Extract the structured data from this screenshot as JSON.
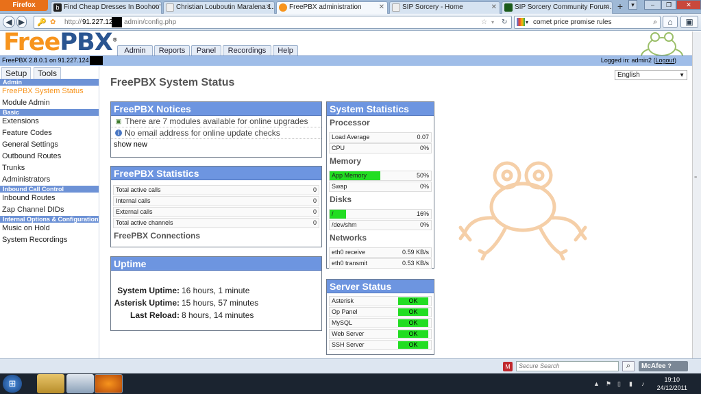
{
  "browser": {
    "menu_button": "Firefox",
    "tabs": [
      {
        "label": "Find Cheap Dresses In Boohoo'...",
        "icon": "b",
        "icon_color": "#222222"
      },
      {
        "label": "Christian Louboutin Maralena 1...",
        "icon": "",
        "icon_color": "#ffffff"
      },
      {
        "label": "FreePBX administration",
        "icon": "",
        "icon_color": "#f7941d"
      },
      {
        "label": "SIP Sorcery - Home",
        "icon": "",
        "icon_color": "#ffffff"
      },
      {
        "label": "SIP Sorcery Community Forum...",
        "icon": "",
        "icon_color": "#1a5a1a"
      }
    ],
    "new_tab": "+",
    "url_scheme": "http://",
    "url_host": "91.227.124",
    "url_path": "admin/config.php",
    "search_text": "comet price promise rules",
    "status_search_placeholder": "Secure Search",
    "mcafee": "McAfee"
  },
  "header": {
    "logo_free": "Free",
    "logo_pbx": "PBX",
    "logo_reg": "®",
    "version": "FreePBX 2.8.0.1 on 91.227.124",
    "logged_in_prefix": "Logged in: admin2 (",
    "logout": "Logout",
    "logged_in_suffix": ")",
    "menu": [
      "Admin",
      "Reports",
      "Panel",
      "Recordings",
      "Help"
    ]
  },
  "sidebar": {
    "tabs": [
      "Setup",
      "Tools"
    ],
    "sections": {
      "admin": "Admin",
      "basic": "Basic",
      "inbound": "Inbound Call Control",
      "internal": "Internal Options & Configuration"
    },
    "admin_items": [
      "FreePBX System Status",
      "Module Admin"
    ],
    "basic_items": [
      "Extensions",
      "Feature Codes",
      "General Settings",
      "Outbound Routes",
      "Trunks",
      "Administrators"
    ],
    "inbound_items": [
      "Inbound Routes",
      "Zap Channel DIDs"
    ],
    "internal_items": [
      "Music on Hold",
      "System Recordings"
    ]
  },
  "main": {
    "title": "FreePBX System Status",
    "language": "English",
    "notices": {
      "title": "FreePBX Notices",
      "items": [
        "There are 7 modules available for online upgrades",
        "No email address for online update checks"
      ],
      "show_new": "show new"
    },
    "statistics": {
      "title": "FreePBX Statistics",
      "rows": [
        {
          "label": "Total active calls",
          "value": "0"
        },
        {
          "label": "Internal calls",
          "value": "0"
        },
        {
          "label": "External calls",
          "value": "0"
        },
        {
          "label": "Total active channels",
          "value": "0"
        }
      ],
      "connections": "FreePBX Connections"
    },
    "uptime": {
      "title": "Uptime",
      "rows": [
        {
          "label": "System Uptime:",
          "value": "16 hours, 1 minute"
        },
        {
          "label": "Asterisk Uptime:",
          "value": "15 hours, 57 minutes"
        },
        {
          "label": "Last Reload:",
          "value": "8 hours, 14 minutes"
        }
      ]
    },
    "system_stats": {
      "title": "System Statistics",
      "processor": "Processor",
      "processor_rows": [
        {
          "label": "Load Average",
          "value": "0.07"
        },
        {
          "label": "CPU",
          "value": "0%"
        }
      ],
      "memory": "Memory",
      "memory_rows": [
        {
          "label": "App Memory",
          "value": "50%",
          "fill": 0.5
        },
        {
          "label": "Swap",
          "value": "0%",
          "fill": 0
        }
      ],
      "disks": "Disks",
      "disk_rows": [
        {
          "label": "/",
          "value": "16%",
          "fill": 0.16
        },
        {
          "label": "/dev/shm",
          "value": "0%",
          "fill": 0
        }
      ],
      "networks": "Networks",
      "network_rows": [
        {
          "label": "eth0 receive",
          "value": "0.59 KB/s"
        },
        {
          "label": "eth0 transmit",
          "value": "0.53 KB/s"
        }
      ]
    },
    "server_status": {
      "title": "Server Status",
      "rows": [
        {
          "label": "Asterisk",
          "status": "OK"
        },
        {
          "label": "Op Panel",
          "status": "OK"
        },
        {
          "label": "MySQL",
          "status": "OK"
        },
        {
          "label": "Web Server",
          "status": "OK"
        },
        {
          "label": "SSH Server",
          "status": "OK"
        }
      ]
    }
  },
  "taskbar": {
    "time": "19:10",
    "date": "24/12/2011"
  },
  "colors": {
    "accent_orange": "#f7941d",
    "box_header": "#6d95e0",
    "ok_green": "#22dd22"
  }
}
